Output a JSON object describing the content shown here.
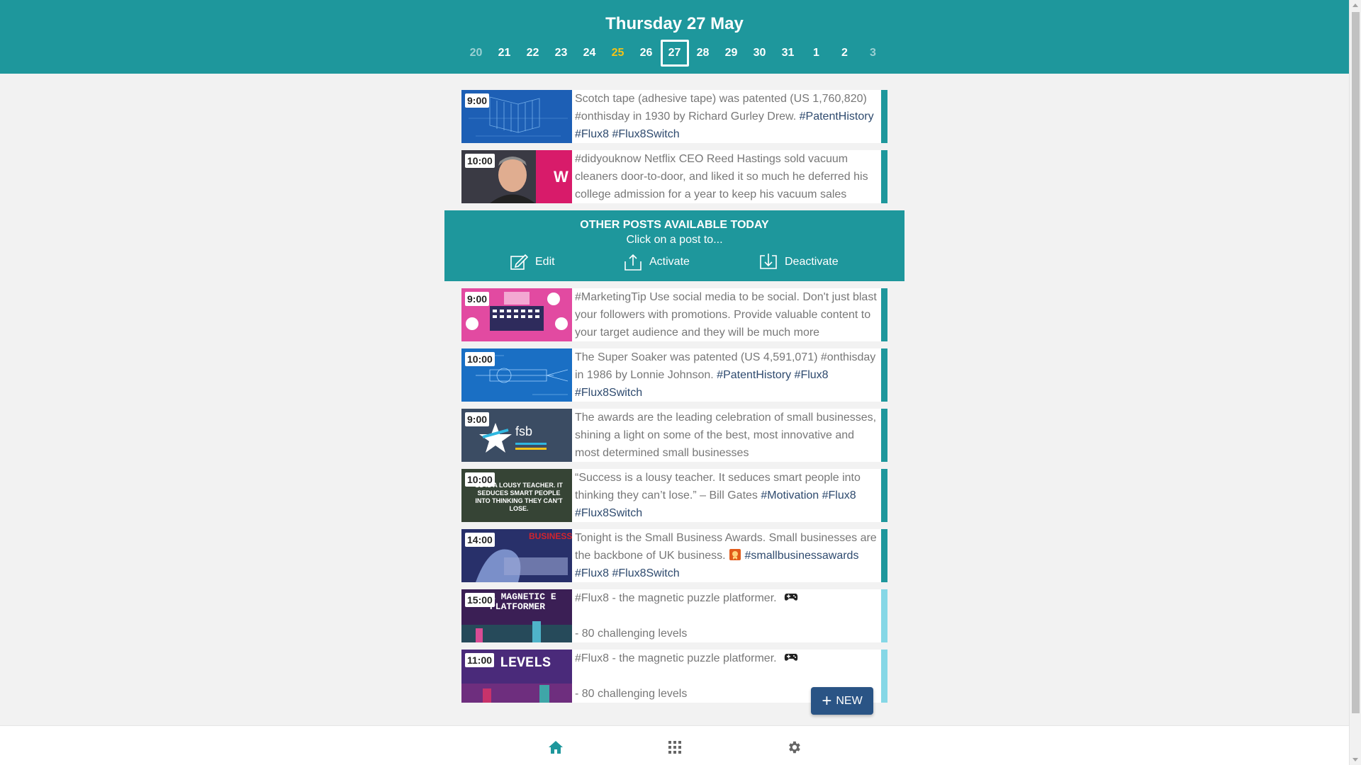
{
  "header": {
    "title": "Thursday 27 May",
    "dates": [
      "20",
      "21",
      "22",
      "23",
      "24",
      "25",
      "26",
      "27",
      "28",
      "29",
      "30",
      "31",
      "1",
      "2",
      "3"
    ]
  },
  "scheduled_posts": [
    {
      "time": "9:00",
      "text": "Scotch tape (adhesive tape) was patented (US 1,760,820) #onthisday in 1930 by Richard Gurley Drew.",
      "tags": "#PatentHistory #Flux8 #Flux8Switch"
    },
    {
      "time": "10:00",
      "text": "#didyouknow Netflix CEO Reed Hastings sold vacuum cleaners door-to-door, and liked it so much he deferred his college admission for a year to keep his vacuum sales",
      "tags": ""
    }
  ],
  "other_panel": {
    "title": "OTHER POSTS AVAILABLE TODAY",
    "subtitle": "Click on a post to...",
    "edit_label": "Edit",
    "activate_label": "Activate",
    "deactivate_label": "Deactivate"
  },
  "other_posts": [
    {
      "time": "9:00",
      "text": "#MarketingTip Use social media to be social. Don't just blast your followers with promotions. Provide valuable content to your target audience and they will be much more",
      "tags": "",
      "thumb_text": ""
    },
    {
      "time": "10:00",
      "text": "The Super Soaker was patented (US 4,591,071) #onthisday in 1986 by Lonnie Johnson.",
      "tags": "#PatentHistory #Flux8 #Flux8Switch",
      "thumb_text": ""
    },
    {
      "time": "9:00",
      "text": "The awards are the leading celebration of small businesses, shining a light on some of the best, most innovative and most determined small businesses",
      "tags": "",
      "thumb_text": "fsb"
    },
    {
      "time": "10:00",
      "text": "“Success is a lousy teacher. It seduces smart people into thinking they can’t lose.” – Bill Gates",
      "tags": "#Motivation #Flux8 #Flux8Switch",
      "thumb_text": "SS IS A LOUSY TEACHER. IT SEDUCES SMART PEOPLE INTO THINKING THEY CAN'T LOSE."
    },
    {
      "time": "14:00",
      "text": "Tonight is the Small Business Awards. Small businesses are the backbone of UK business. ",
      "tags": "#smallbusinessawards #Flux8 #Flux8Switch",
      "thumb_text": "BUSINESS"
    },
    {
      "time": "15:00",
      "text": "#Flux8 - the magnetic puzzle platformer. ",
      "tags": "",
      "line3": " - 80 challenging levels",
      "thumb_text": "E MAGNETIC E PLATFORMER"
    },
    {
      "time": "11:00",
      "text": "#Flux8 - the magnetic puzzle platformer. ",
      "tags": "",
      "line3": " - 80 challenging levels",
      "thumb_text": "LEVELS"
    }
  ],
  "new_button": {
    "label": "NEW"
  },
  "colors": {
    "teal": "#1e979c",
    "navy": "#2a5485",
    "tag": "#2e4a6e",
    "light_bar": "#86d7e6",
    "today_accent": "#f3c318"
  },
  "icons": {
    "edit": "edit-icon",
    "activate": "upload-icon",
    "deactivate": "download-icon",
    "home": "home-icon",
    "grid": "grid-icon",
    "settings": "gear-icon",
    "game": "gamepad-icon",
    "award": "award-emoji-icon"
  }
}
